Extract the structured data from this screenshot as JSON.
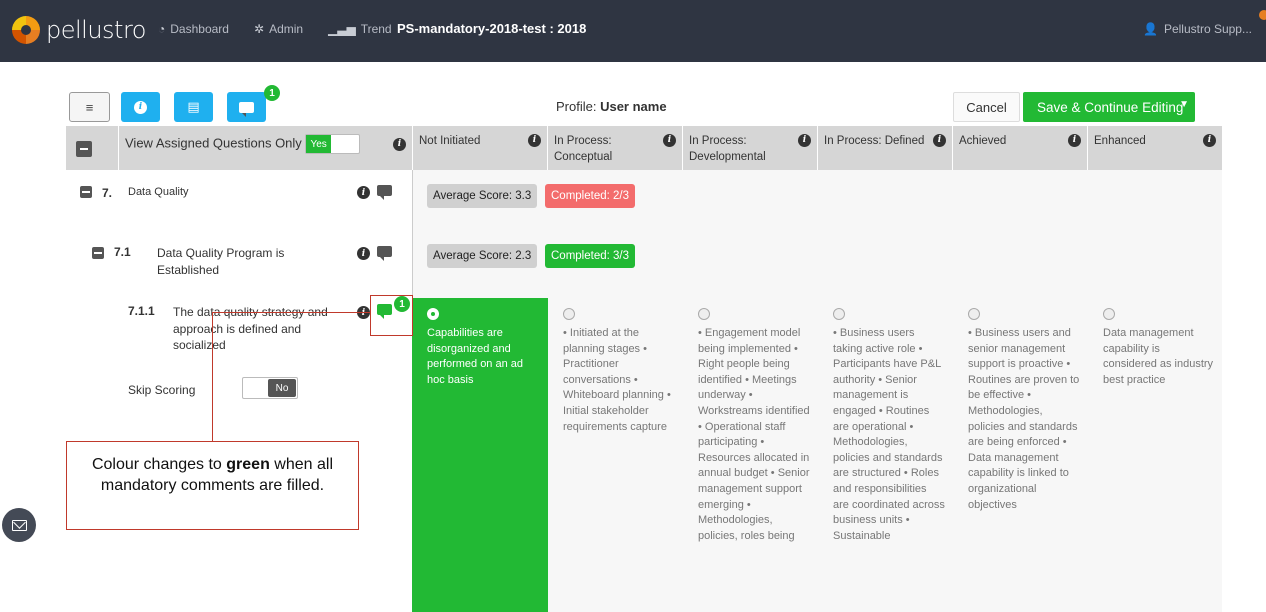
{
  "app": {
    "logo_text": "pellustro",
    "title": "PS-mandatory-2018-test : 2018"
  },
  "nav": [
    {
      "label": "Dashboard",
      "icon": "gauge-icon"
    },
    {
      "label": "Admin",
      "icon": "gear-icon"
    },
    {
      "label": "Trend",
      "icon": "bar-chart-icon"
    }
  ],
  "user": {
    "name": "Pellustro Supp..."
  },
  "toolbar": {
    "menu_symbol": "≡",
    "info_symbol": "i",
    "doc_symbol": "▤",
    "comment_badge": "1",
    "profile_prefix": "Profile: ",
    "profile_name": "User name",
    "cancel_label": "Cancel",
    "save_label": "Save & Continue Editing"
  },
  "header": {
    "view_assigned_label": "View Assigned Questions Only",
    "toggle_yes": "Yes",
    "levels": [
      "Not Initiated",
      "In Process: Conceptual",
      "In Process: Developmental",
      "In Process: Defined",
      "Achieved",
      "Enhanced"
    ]
  },
  "section": {
    "number": "7.",
    "title": "Data Quality",
    "avg_score": "Average Score: 3.3",
    "completed": "Completed: 2/3"
  },
  "subsection": {
    "number": "7.1",
    "title": "Data Quality Program is Established",
    "avg_score": "Average Score: 2.3",
    "completed": "Completed: 3/3"
  },
  "question": {
    "number": "7.1.1",
    "text": "The data quality strategy and approach is defined and socialized",
    "comment_badge": "1",
    "skip_label": "Skip Scoring",
    "skip_value": "No"
  },
  "level_texts": [
    "Capabilities are disorganized and performed on an ad hoc basis",
    "• Initiated at the planning stages • Practitioner conversations • Whiteboard planning • Initial stakeholder requirements capture",
    "• Engagement model being implemented • Right people being identified • Meetings underway • Workstreams identified • Operational staff participating • Resources allocated in annual budget • Senior management support emerging • Methodologies, policies, roles being",
    "• Business users taking active role • Participants have P&L authority • Senior management is engaged • Routines are operational • Methodologies, policies and standards are structured • Roles and responsibilities are coordinated across business units • Sustainable",
    "• Business users and senior management support is proactive • Routines are proven to be effective • Methodologies, policies and standards are being enforced • Data management capability is linked to organizational objectives",
    "Data management capability is considered as industry best practice"
  ],
  "callout": {
    "text_before": "Colour changes to ",
    "text_bold": "green",
    "text_after": " when all mandatory comments are filled."
  },
  "colors": {
    "topbar": "#2f3542",
    "accent_green": "#22b934",
    "accent_blue": "#1fb0ef",
    "completed_red": "#f36c6c",
    "callout_border": "#c0392b"
  }
}
